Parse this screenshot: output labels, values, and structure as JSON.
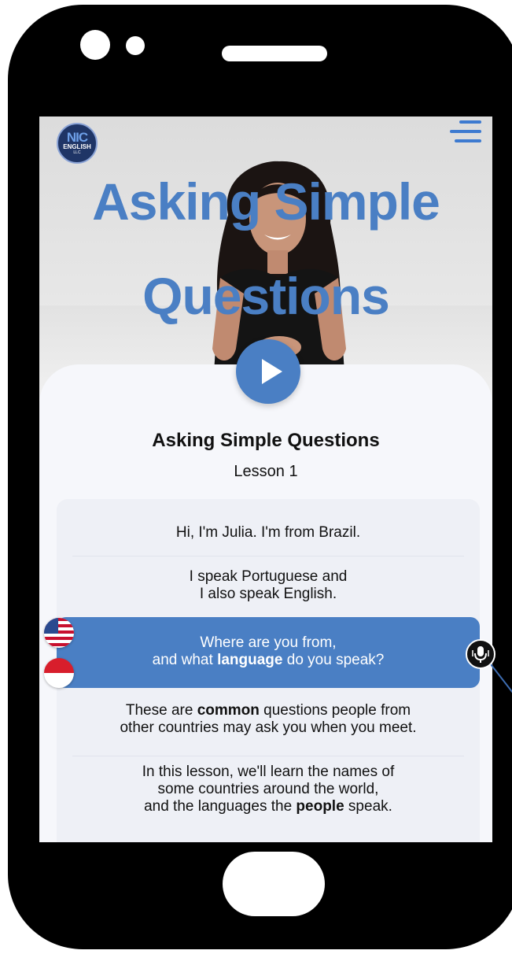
{
  "app": {
    "logo_text": "NIC",
    "logo_sub": "ENGLISH",
    "logo_sub2": "LLC"
  },
  "hero": {
    "title_line1": "Asking Simple",
    "title_line2": "Questions"
  },
  "lesson": {
    "title": "Asking Simple Questions",
    "subtitle": "Lesson 1"
  },
  "transcript": {
    "line1": "Hi, I'm Julia. I'm from Brazil.",
    "line2a": "I speak Portuguese and",
    "line2b": "I also speak English.",
    "highlight": {
      "a": "Where are you from,",
      "b_pre": "and what ",
      "b_bold": "language",
      "b_post": " do you speak?"
    },
    "line4": {
      "a_pre": "These are ",
      "a_bold": "common",
      "a_post": " questions people from",
      "b": "other countries may ask you when you meet."
    },
    "line5": {
      "a": "In this lesson, we'll learn the names of",
      "b": "some countries around the world,",
      "c_pre": "and the languages the ",
      "c_bold": "people",
      "c_post": " speak."
    }
  },
  "colors": {
    "accent": "#4a7fc4",
    "title": "#4a7fc4",
    "card_bg": "#f6f7fb"
  },
  "icons": {
    "menu": "hamburger-menu-icon",
    "play": "play-icon",
    "mic": "microphone-icon",
    "flag_en": "us-flag-icon",
    "flag_id": "indonesia-flag-icon"
  }
}
